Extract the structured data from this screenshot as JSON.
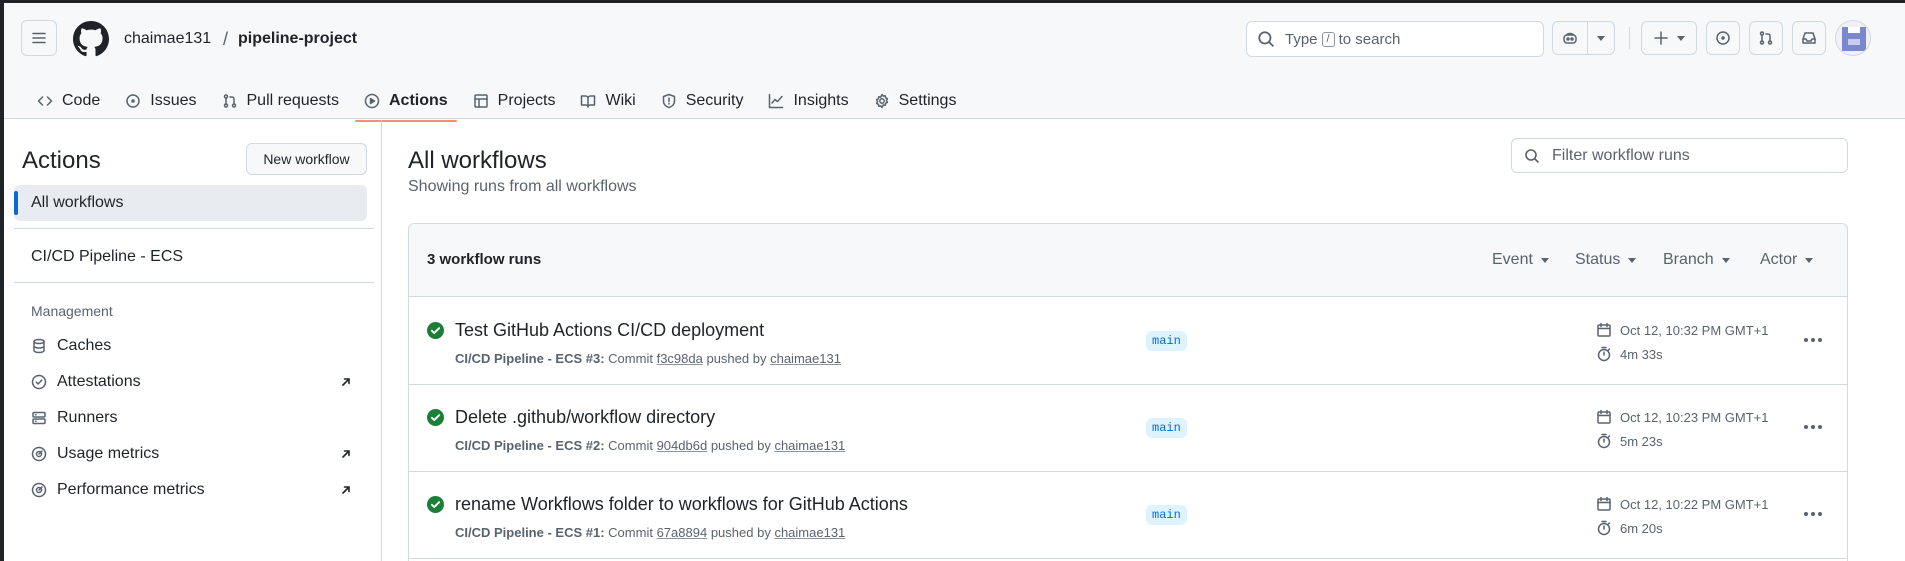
{
  "header": {
    "owner": "chaimae131",
    "separator": "/",
    "repo": "pipeline-project",
    "search": {
      "prefix": "Type",
      "key": "/",
      "suffix": "to search"
    }
  },
  "repo_nav": [
    {
      "label": "Code",
      "icon": "code-icon"
    },
    {
      "label": "Issues",
      "icon": "issue-icon"
    },
    {
      "label": "Pull requests",
      "icon": "pull-request-icon"
    },
    {
      "label": "Actions",
      "icon": "play-icon",
      "active": true
    },
    {
      "label": "Projects",
      "icon": "table-icon"
    },
    {
      "label": "Wiki",
      "icon": "book-icon"
    },
    {
      "label": "Security",
      "icon": "shield-icon"
    },
    {
      "label": "Insights",
      "icon": "graph-icon"
    },
    {
      "label": "Settings",
      "icon": "gear-icon"
    }
  ],
  "sidebar": {
    "title": "Actions",
    "new_workflow": "New workflow",
    "all_workflows": "All workflows",
    "workflows": [
      "CI/CD Pipeline - ECS"
    ],
    "management_heading": "Management",
    "management": [
      {
        "label": "Caches",
        "icon": "database-icon",
        "external": false
      },
      {
        "label": "Attestations",
        "icon": "verified-icon",
        "external": true
      },
      {
        "label": "Runners",
        "icon": "server-icon",
        "external": false
      },
      {
        "label": "Usage metrics",
        "icon": "meter-icon",
        "external": true
      },
      {
        "label": "Performance metrics",
        "icon": "meter-icon",
        "external": true
      }
    ]
  },
  "main": {
    "title": "All workflows",
    "subtitle": "Showing runs from all workflows",
    "filter_placeholder": "Filter workflow runs",
    "runs_count": "3 workflow runs",
    "filters": [
      "Event",
      "Status",
      "Branch",
      "Actor"
    ],
    "runs": [
      {
        "title": "Test GitHub Actions CI/CD deployment",
        "workflow": "CI/CD Pipeline - ECS #3:",
        "commit_label": "Commit",
        "commit": "f3c98da",
        "pushed_by": "pushed by",
        "actor": "chaimae131",
        "branch": "main",
        "date": "Oct 12, 10:32 PM GMT+1",
        "duration": "4m 33s"
      },
      {
        "title": "Delete .github/workflow directory",
        "workflow": "CI/CD Pipeline - ECS #2:",
        "commit_label": "Commit",
        "commit": "904db6d",
        "pushed_by": "pushed by",
        "actor": "chaimae131",
        "branch": "main",
        "date": "Oct 12, 10:23 PM GMT+1",
        "duration": "5m 23s"
      },
      {
        "title": "rename Workflows folder to workflows for GitHub Actions",
        "workflow": "CI/CD Pipeline - ECS #1:",
        "commit_label": "Commit",
        "commit": "67a8894",
        "pushed_by": "pushed by",
        "actor": "chaimae131",
        "branch": "main",
        "date": "Oct 12, 10:22 PM GMT+1",
        "duration": "6m 20s"
      }
    ]
  },
  "colors": {
    "success": "#1a7f37",
    "accent": "#0969da",
    "tab_underline": "#fd8c73"
  }
}
